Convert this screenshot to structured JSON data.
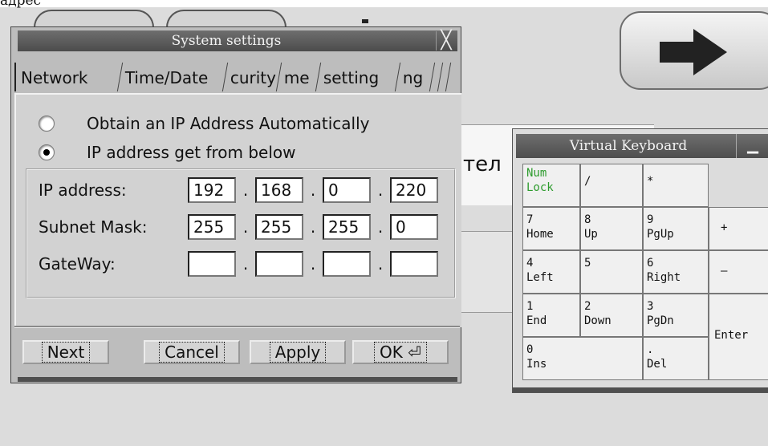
{
  "background": {
    "top_label": "адрес",
    "partial_text": "тел"
  },
  "dialog": {
    "title": "System settings",
    "tabs": [
      {
        "label": "Network",
        "active": true
      },
      {
        "label": "Time/Date",
        "active": false
      },
      {
        "label": "curity",
        "active": false
      },
      {
        "label": "me",
        "active": false
      },
      {
        "label": "setting",
        "active": false
      },
      {
        "label": "ng",
        "active": false
      }
    ],
    "radios": [
      {
        "label": "Obtain an IP Address Automatically",
        "checked": false
      },
      {
        "label": "IP address get from below",
        "checked": true
      }
    ],
    "ip_address": {
      "label": "IP address:",
      "octets": [
        "192",
        "168",
        "0",
        "220"
      ]
    },
    "subnet_mask": {
      "label": "Subnet Mask:",
      "octets": [
        "255",
        "255",
        "255",
        "0"
      ]
    },
    "gateway": {
      "label": "GateWay:",
      "octets": [
        "",
        "",
        "",
        ""
      ]
    },
    "buttons": {
      "next": "Next",
      "cancel": "Cancel",
      "apply": "Apply",
      "ok": "OK",
      "ok_icon": "enter-icon"
    }
  },
  "keyboard": {
    "title": "Virtual Keyboard",
    "keys": {
      "numlock": [
        "Num",
        "Lock"
      ],
      "slash": "/",
      "asterisk": "*",
      "k7": [
        "7",
        "Home"
      ],
      "k8": [
        "8",
        "Up"
      ],
      "k9": [
        "9",
        "PgUp"
      ],
      "plus": "+",
      "k4": [
        "4",
        "Left"
      ],
      "k5": "5",
      "k6": [
        "6",
        "Right"
      ],
      "minus": "–",
      "k1": [
        "1",
        "End"
      ],
      "k2": [
        "2",
        "Down"
      ],
      "k3": [
        "3",
        "PgDn"
      ],
      "enter": "Enter",
      "k0": [
        "0",
        "Ins"
      ],
      "dot": [
        ".",
        "Del"
      ]
    }
  }
}
